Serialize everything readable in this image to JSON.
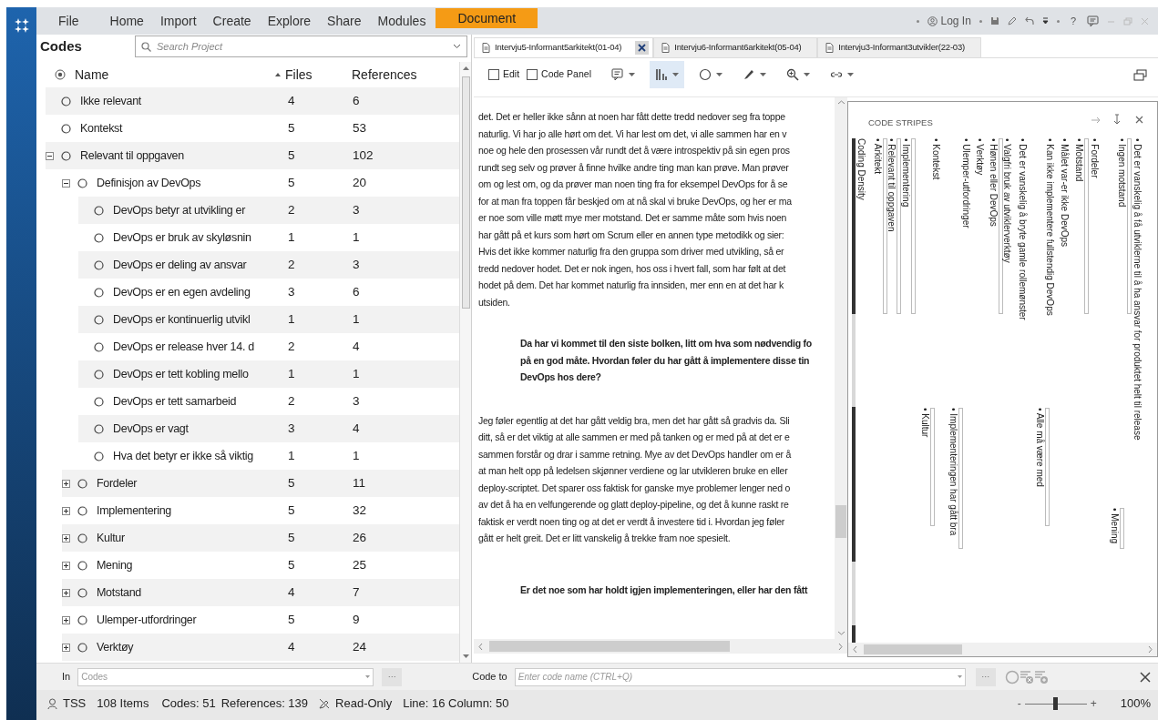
{
  "menu": [
    {
      "label": "File",
      "selected": false
    },
    {
      "label": "Home",
      "selected": false
    },
    {
      "label": "Import",
      "selected": false
    },
    {
      "label": "Create",
      "selected": false
    },
    {
      "label": "Explore",
      "selected": false
    },
    {
      "label": "Share",
      "selected": false
    },
    {
      "label": "Modules",
      "selected": false
    },
    {
      "label": "Document",
      "selected": true
    }
  ],
  "account": {
    "label": "Log In",
    "help": "?"
  },
  "codes_panel": {
    "title": "Codes",
    "search": {
      "placeholder": "Search Project"
    },
    "columns": [
      {
        "label": "Name",
        "sorted": false
      },
      {
        "label": "Files",
        "sorted": true
      },
      {
        "label": "References",
        "sorted": false
      }
    ],
    "rows": [
      {
        "name": "Ikke relevant",
        "files": "4",
        "references": "6"
      },
      {
        "name": "Kontekst",
        "files": "5",
        "references": "53"
      },
      {
        "name": "Relevant til oppgaven",
        "files": "5",
        "references": "102",
        "expanded": true,
        "children": [
          {
            "name": "Definisjon av DevOps",
            "files": "5",
            "references": "20",
            "expanded": true,
            "children": [
              {
                "name": "DevOps betyr at utvikling er",
                "files": "2",
                "references": "3"
              },
              {
                "name": "DevOps er bruk av skyløsnin",
                "files": "1",
                "references": "1"
              },
              {
                "name": "DevOps er deling av ansvar",
                "files": "2",
                "references": "3"
              },
              {
                "name": "DevOps er en egen avdeling",
                "files": "3",
                "references": "6"
              },
              {
                "name": "DevOps er kontinuerlig utvikl",
                "files": "1",
                "references": "1"
              },
              {
                "name": "DevOps er release hver 14. d",
                "files": "2",
                "references": "4"
              },
              {
                "name": "DevOps er tett kobling mello",
                "files": "1",
                "references": "1"
              },
              {
                "name": "DevOps er tett samarbeid",
                "files": "2",
                "references": "3"
              },
              {
                "name": "DevOps er vagt",
                "files": "3",
                "references": "4"
              },
              {
                "name": "Hva det betyr er ikke så viktig",
                "files": "1",
                "references": "1"
              }
            ]
          },
          {
            "name": "Fordeler",
            "files": "5",
            "references": "11",
            "expanded": false
          },
          {
            "name": "Implementering",
            "files": "5",
            "references": "32",
            "expanded": false
          },
          {
            "name": "Kultur",
            "files": "5",
            "references": "26",
            "expanded": false
          },
          {
            "name": "Mening",
            "files": "5",
            "references": "25",
            "expanded": false
          },
          {
            "name": "Motstand",
            "files": "4",
            "references": "7",
            "expanded": false
          },
          {
            "name": "Ulemper-utfordringer",
            "files": "5",
            "references": "9",
            "expanded": false
          },
          {
            "name": "Verktøy",
            "files": "4",
            "references": "24",
            "expanded": false
          }
        ]
      }
    ]
  },
  "document_tabs": [
    {
      "label": "Intervju5-Informant5arkitekt(01-04)",
      "selected": true
    },
    {
      "label": "Intervju6-Informant6arkitekt(05-04)",
      "selected": false
    },
    {
      "label": "Intervju3-Informant3utvikler(22-03)",
      "selected": false
    }
  ],
  "toolbar": {
    "checkboxes": [
      {
        "label": "Edit",
        "checked": false
      },
      {
        "label": "Code Panel",
        "checked": false
      }
    ],
    "tools": [
      {
        "kind": "comment",
        "selected": false
      },
      {
        "kind": "stripes",
        "selected": true
      },
      {
        "kind": "shape",
        "selected": false
      },
      {
        "kind": "highlighter",
        "selected": false
      },
      {
        "kind": "zoom",
        "selected": false
      },
      {
        "kind": "link",
        "selected": false
      }
    ]
  },
  "document": {
    "paragraphs": [
      {
        "kind": "answer",
        "lines": [
          "det. Det er heller ikke sånn at noen har fått dette tredd nedover seg fra toppe",
          "naturlig. Vi har jo alle hørt om det. Vi har lest om det, vi alle sammen har en v",
          "noe og hele den prosessen vår rundt det å være introspektiv på sin egen pros",
          "rundt seg selv og prøver å finne hvilke andre ting man kan prøve. Man prøver",
          "om og lest om, og da prøver man noen ting fra for eksempel DevOps for å se",
          "for at man fra toppen får beskjed om at nå skal vi bruke DevOps, og her er ma",
          "er noe som ville møtt mye mer motstand. Det er samme måte som hvis noen",
          "har gått på et kurs som hørt om Scrum eller en annen type metodikk og sier:",
          "Hvis det ikke kommer naturlig fra den gruppa som driver med utvikling, så er",
          "tredd nedover hodet. Det er nok ingen, hos oss i hvert fall, som har følt at det",
          "hodet på dem. Det har kommet naturlig fra innsiden, mer enn en at det har k",
          "utsiden."
        ]
      },
      {
        "kind": "question",
        "lines": [
          "Da har vi kommet til den siste bolken, litt om hva som nødvendig fo",
          "på en god måte. Hvordan føler du har gått å implementere disse tin",
          "DevOps hos dere?"
        ]
      },
      {
        "kind": "answer",
        "lines": [
          "Jeg føler egentlig at det har gått veldig bra, men det har gått så gradvis da. Sli",
          "ditt, så er det viktig at alle sammen er med på tanken og er med på at det er e",
          "sammen forstår og drar i samme retning. Mye av det DevOps handler om er å",
          "at man helt opp på ledelsen skjønner verdiene og lar utvikleren bruke en eller",
          "deploy-scriptet. Det sparer oss faktisk for ganske mye problemer lenger ned o",
          "av det å ha en velfungerende og glatt deploy-pipeline, og det å kunne raskt re",
          "faktisk er verdt noen ting og at det er verdt å investere tid i. Hvordan jeg føler",
          "gått er helt greit. Det er litt vanskelig å trekke fram noe spesielt."
        ]
      },
      {
        "kind": "question",
        "lines": [
          "Er det noe som har holdt igjen implementeringen, eller har den fått"
        ]
      }
    ]
  },
  "code_stripes": {
    "title": "CODE STRIPES",
    "density_label": "Coding Density",
    "upper": [
      "• Arkitekt",
      "• Relevant til oppgaven",
      "• Implementering",
      "• Kontekst",
      "• Ulemper-utfordringer",
      "• Verktøy",
      "• Hønen eller DevOps",
      "• Valgfri bruk av utviklerverktøy",
      "• Det er vanskelig å bryte gamle rollemønster",
      "• Kan ikke implementere fullstendig DevOps",
      "• Målet var-er ikke DevOps",
      "• Motstand",
      "• Fordeler",
      "• Ingen motstand",
      "• Det er vanskelig å få utviklerne til å ha ansvar for produktet helt til release"
    ],
    "lower": [
      "• Kultur",
      "• Implementeringen har gått bra",
      "• Alle må være med",
      "• Mening"
    ]
  },
  "coding_bar": {
    "in_label": "In",
    "in_field": {
      "placeholder": "Codes"
    },
    "more": "···",
    "code_to_label": "Code to",
    "code_to_field": {
      "placeholder": "Enter code name (CTRL+Q)"
    },
    "more_2": "···"
  },
  "status_bar": {
    "user": "TSS",
    "items": "108 Items",
    "codes": "Codes: 51",
    "references": "References: 139",
    "mode": "Read-Only",
    "position": "Line: 16 Column: 50",
    "zoom_minus": "-",
    "zoom": {
      "level": 0.5
    },
    "zoom_plus": "+",
    "zoom_reading": "100%"
  }
}
